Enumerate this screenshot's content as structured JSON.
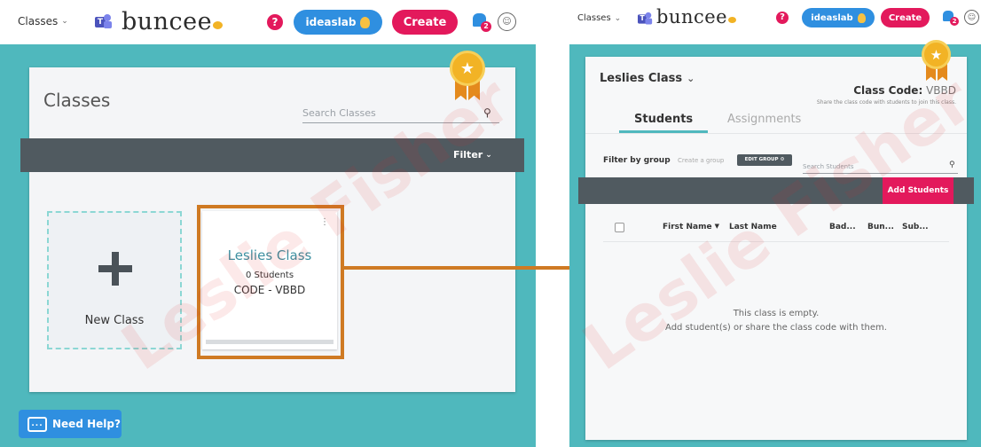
{
  "left": {
    "nav": {
      "dropdown": "Classes",
      "brand": "buncee",
      "ideaslab": "ideaslab",
      "create": "Create",
      "notif_count": "2"
    },
    "classes": {
      "title": "Classes",
      "search_placeholder": "Search Classes",
      "filter_label": "Filter",
      "new_class_label": "New Class",
      "class_tile": {
        "name": "Leslies Class",
        "students": "0 Students",
        "code": "CODE - VBBD"
      }
    },
    "need_help": "Need Help?",
    "chat_dots": "..."
  },
  "right": {
    "nav": {
      "dropdown": "Classes",
      "brand": "buncee",
      "ideaslab": "ideaslab",
      "create": "Create",
      "notif_count": "2"
    },
    "class_name": "Leslies Class",
    "class_code_label": "Class Code:",
    "class_code": "VBBD",
    "share_hint": "Share the class code with students to join this class.",
    "tabs": [
      "Students",
      "Assignments"
    ],
    "filter_by_group": "Filter by group",
    "create_group": "Create a group",
    "edit_group": "EDIT GROUP",
    "search_students": "Search Students",
    "add_students": "Add Students",
    "columns": [
      "First Name",
      "Last Name",
      "Bad...",
      "Bun...",
      "Sub..."
    ],
    "empty_line1": "This class is empty.",
    "empty_line2": "Add student(s) or share the class code with them."
  },
  "watermark": "Leslie Fisher",
  "colors": {
    "teal": "#4fb8bd",
    "pink": "#e3195c",
    "blue": "#2f8fe0",
    "dark": "#505a60",
    "orange": "#cf7a23",
    "gold": "#f2b325"
  }
}
